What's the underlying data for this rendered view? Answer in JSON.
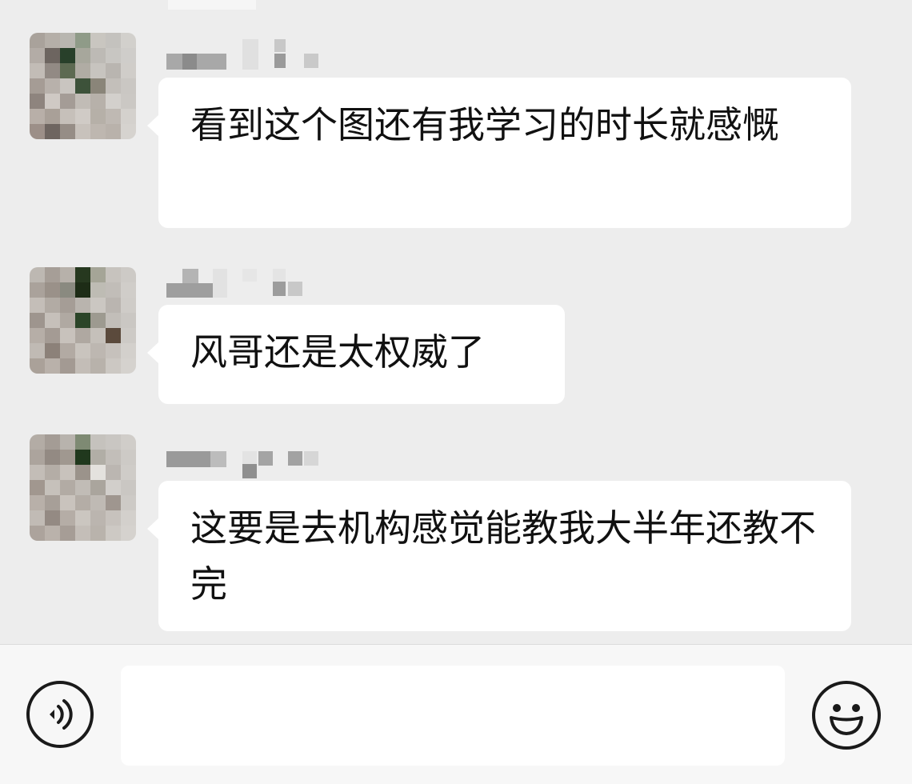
{
  "messages": [
    {
      "avatar": "blurred-avatar",
      "sender": "",
      "text": "看到这个图还有我学习的时长就感慨"
    },
    {
      "avatar": "blurred-avatar",
      "sender": "",
      "text": "风哥还是太权威了"
    },
    {
      "avatar": "blurred-avatar",
      "sender": "",
      "text": "这要是去机构感觉能教我大半年还教不完"
    }
  ],
  "input_bar": {
    "voice_icon": "voice-icon",
    "input_value": "",
    "input_placeholder": "",
    "emoji_icon": "emoji-icon"
  },
  "colors": {
    "background": "#ededed",
    "bubble": "#ffffff",
    "text": "#111111",
    "input_bar": "#f7f7f7"
  }
}
